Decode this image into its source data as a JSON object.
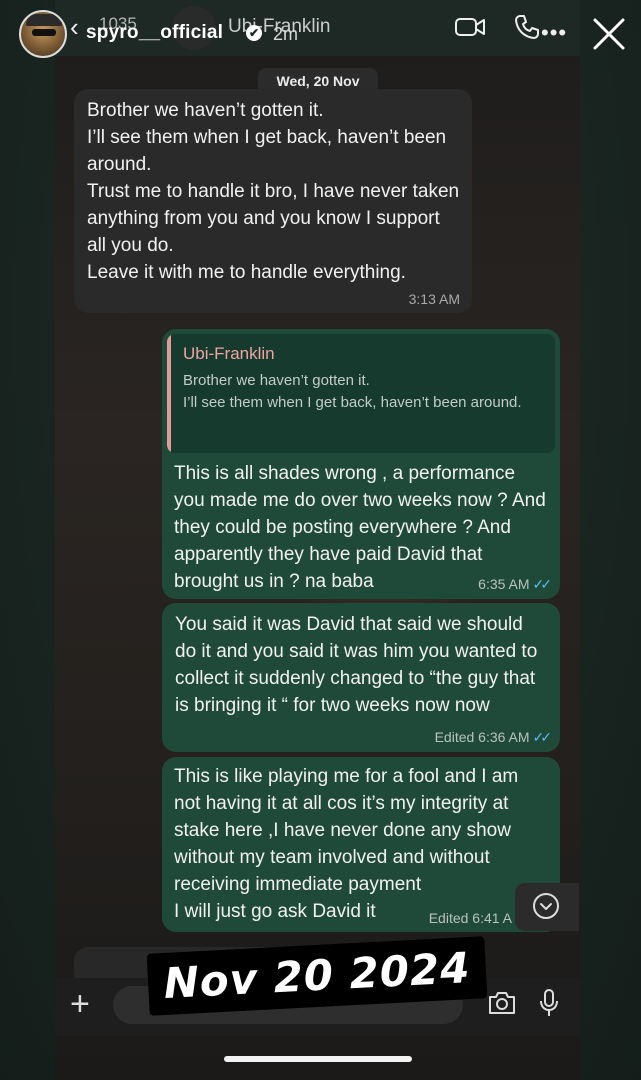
{
  "story": {
    "username": "spyro__official",
    "verified_mark": "✔",
    "time_ago": "2m",
    "close_icon": "close-icon"
  },
  "chat_header": {
    "back_glyph": "‹",
    "unread_count": "1035",
    "contact_name": "Ubi-Franklin",
    "more": "•••"
  },
  "date_separator": "Wed, 20 Nov",
  "messages": [
    {
      "direction": "incoming",
      "text": "Brother we haven’t gotten it.\nI’ll see them when I get back, haven’t been around.\nTrust me to handle it bro, I have never taken anything from you and you know I support all you do.\nLeave it with me to handle everything.",
      "time": "3:13 AM"
    },
    {
      "direction": "outgoing",
      "quote_name": "Ubi-Franklin",
      "quote_text": "Brother we haven’t gotten it.\nI’ll see them when I get back, haven’t been around.",
      "text": "This is all shades wrong , a performance you made me do over two weeks now ? And they could be posting everywhere ? And apparently they have paid David that brought us in ? na baba",
      "time": "6:35 AM",
      "ticks": "✓✓"
    },
    {
      "direction": "outgoing",
      "text": "You said it was David that said we should do it and you said it was him you wanted to collect it suddenly changed to “the guy that is bringing it “ for two weeks now now",
      "time": "Edited 6:36 AM",
      "ticks": "✓✓"
    },
    {
      "direction": "outgoing",
      "text": "This is like playing me for a fool and I am not having it  at all cos it’s my integrity at stake here ,I have never done any show without my team involved and without receiving immediate payment\nI will just go ask David it",
      "time": "Edited 6:41 A"
    }
  ],
  "input_bar": {
    "plus": "+"
  },
  "sticker_text": "Nov 20 2024",
  "colors": {
    "outgoing_bubble": "#1f4a3a",
    "incoming_bubble": "#2a2a2a",
    "quote_accent": "#e39a9a",
    "read_ticks": "#53bdeb"
  }
}
